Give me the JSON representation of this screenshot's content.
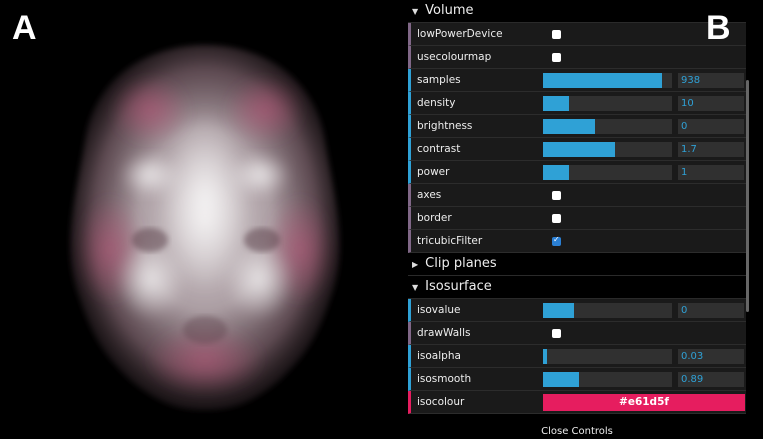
{
  "labels": {
    "a": "A",
    "b": "B"
  },
  "gui": {
    "volume": {
      "title": "Volume",
      "rows": [
        {
          "name": "lowPowerDevice",
          "type": "bool",
          "checked": false
        },
        {
          "name": "usecolourmap",
          "type": "bool",
          "checked": false
        },
        {
          "name": "samples",
          "type": "num",
          "value": "938",
          "fill": 0.92
        },
        {
          "name": "density",
          "type": "num",
          "value": "10",
          "fill": 0.2
        },
        {
          "name": "brightness",
          "type": "num",
          "value": "0",
          "fill": 0.4
        },
        {
          "name": "contrast",
          "type": "num",
          "value": "1.7",
          "fill": 0.56
        },
        {
          "name": "power",
          "type": "num",
          "value": "1",
          "fill": 0.2
        },
        {
          "name": "axes",
          "type": "bool",
          "checked": false
        },
        {
          "name": "border",
          "type": "bool",
          "checked": false
        },
        {
          "name": "tricubicFilter",
          "type": "bool",
          "checked": true
        }
      ]
    },
    "clip_planes": {
      "title": "Clip planes"
    },
    "isosurface": {
      "title": "Isosurface",
      "rows": [
        {
          "name": "isovalue",
          "type": "num",
          "value": "0",
          "fill": 0.24
        },
        {
          "name": "drawWalls",
          "type": "bool",
          "checked": false
        },
        {
          "name": "isoalpha",
          "type": "num",
          "value": "0.03",
          "fill": 0.03
        },
        {
          "name": "isosmooth",
          "type": "num",
          "value": "0.89",
          "fill": 0.28
        },
        {
          "name": "isocolour",
          "type": "color",
          "value": "#e61d5f",
          "display": "#e61d5f"
        }
      ]
    },
    "close_label": "Close Controls"
  },
  "colors": {
    "accent": "#2fa1d6",
    "iso": "#e61d5f",
    "volume_tint": "#c85a80"
  }
}
